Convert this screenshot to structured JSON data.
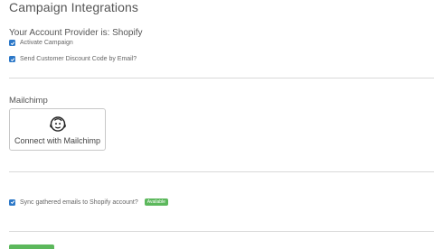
{
  "page": {
    "title": "Campaign Integrations"
  },
  "provider": {
    "text": "Your Account Provider is: Shopify"
  },
  "options": {
    "activate_campaign": {
      "label": "Activate Campaign",
      "checked": true
    },
    "send_discount": {
      "label": "Send Customer Discount Code by Email?",
      "checked": true
    },
    "sync_emails": {
      "label": "Sync gathered emails to Shopify account?",
      "checked": true,
      "badge": "Available"
    }
  },
  "mailchimp": {
    "section_title": "Mailchimp",
    "connect_label": "Connect with Mailchimp",
    "icon": "mailchimp-logo-icon"
  },
  "colors": {
    "checkbox": "#2c78c8",
    "badge": "#5cb85c",
    "save_button": "#5cb85c"
  }
}
